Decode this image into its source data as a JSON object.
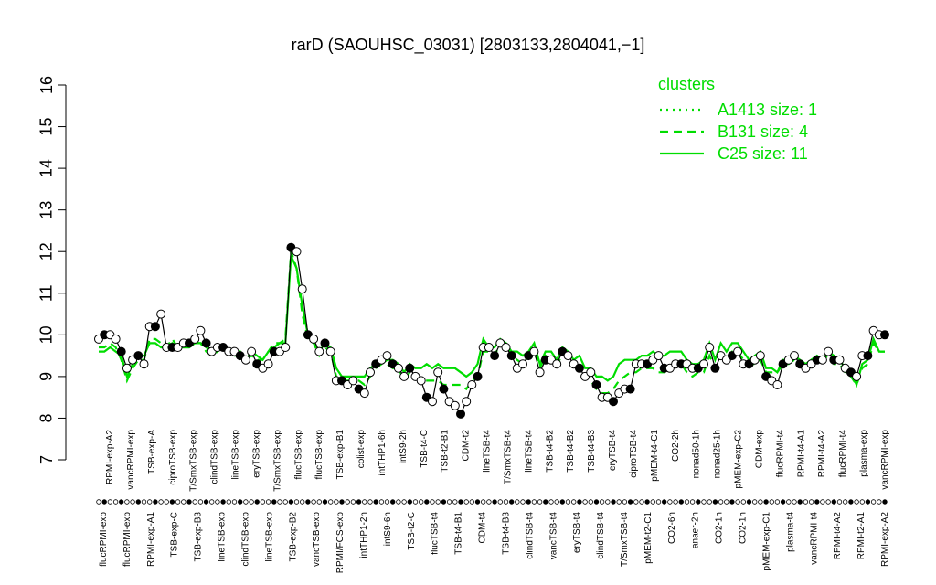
{
  "chart_data": {
    "type": "line",
    "title": "rarD (SAOUHSC_03031) [2803133,2804041,−1]",
    "xlabel": "",
    "ylabel": "",
    "ylim": [
      7,
      16
    ],
    "yticks": [
      7,
      8,
      9,
      10,
      11,
      12,
      13,
      14,
      15,
      16
    ],
    "legend": {
      "title": "clusters",
      "position": "top-right",
      "color": "#00dd00",
      "items": [
        {
          "label": "A1413 size: 1",
          "dash": "dotted"
        },
        {
          "label": "B131 size: 4",
          "dash": "dashed"
        },
        {
          "label": "C25 size: 11",
          "dash": "solid"
        }
      ]
    },
    "top_labels": [
      "RPMI-exp-A2",
      "vancRPMI-exp",
      "TSB-exp-A",
      "ciproTSB-exp",
      "T/SmxTSB-exp",
      "clindTSB-exp",
      "lineTSB-exp",
      "eryTSB-exp",
      "T/SmxTSB-exp",
      "flucTSB-exp",
      "flucTSB-exp",
      "TSB-exp-B1",
      "colist-exp",
      "intTHP1-6h",
      "intS9-2h",
      "TSB-t4-C",
      "TSB-t2-B1",
      "CDM-t2",
      "lineTSB-t4",
      "T/SmxTSB-t4",
      "lineTSB-t4",
      "TSB-t4-B2",
      "TSB-t4-B2",
      "TSB-t4-B3",
      "eryTSB-t4",
      "ciproTSB-t4",
      "pMEM-t4-C1",
      "CO2-2h",
      "nonad50-1h",
      "nonad25-1h",
      "pMEM-exp-C2",
      "CDM-exp",
      "flucRPMI-t4",
      "RPMI-t4-A1",
      "RPMI-t4-A2",
      "flucRPMI-t4",
      "plasma-exp",
      "vancRPMI-exp"
    ],
    "bottom_labels": [
      "flucRPMI-exp",
      "flucRPMI-exp",
      "RPMI-exp-A1",
      "TSB-exp-C",
      "TSB-exp-B3",
      "lineTSB-exp",
      "clindTSB-exp",
      "lineTSB-exp",
      "TSB-exp-B2",
      "vancTSB-exp",
      "RPMI/FCS-exp",
      "intTHP1-2h",
      "intS9-6h",
      "TSB-t2-C",
      "flucTSB-t4",
      "TSB-t4-B1",
      "CDM-t4",
      "TSB-t4-B3",
      "clindTSB-t4",
      "vancTSB-t4",
      "eryTSB-t4",
      "clindTSB-t4",
      "T/SmxTSB-t4",
      "pMEM-t2-C1",
      "CO2-6h",
      "anaer-2h",
      "CO2-1h",
      "CO2-1h",
      "pMEM-exp-C1",
      "plasma-t4",
      "vancRPMI-t4",
      "RPMI-t4-A2",
      "RPMI-t2-A1",
      "RPMI-exp-A2"
    ],
    "series": [
      {
        "name": "C25 size: 11",
        "style": "solid",
        "x": [
          1,
          2,
          3,
          4,
          5,
          6,
          7,
          8,
          9,
          10,
          11,
          12,
          13,
          14,
          15,
          16,
          17,
          18,
          19,
          20,
          21,
          22,
          23,
          24,
          25,
          26,
          27,
          28,
          29,
          30,
          31,
          32,
          33,
          34,
          35,
          36,
          37,
          38,
          39,
          40,
          41,
          42,
          43,
          44,
          45,
          46,
          47,
          48,
          49,
          50,
          51,
          52,
          53,
          54,
          55,
          56,
          57,
          58,
          59,
          60,
          61,
          62,
          63,
          64,
          65,
          66,
          67,
          68,
          69,
          70,
          71,
          72,
          73,
          74,
          75,
          76,
          77,
          78,
          79,
          80,
          81,
          82,
          83,
          84,
          85,
          86,
          87,
          88,
          89,
          90,
          91,
          92,
          93,
          94,
          95,
          96,
          97,
          98,
          99,
          100,
          101,
          102,
          103,
          104,
          105,
          106,
          107,
          108,
          109,
          110,
          111,
          112,
          113,
          114,
          115,
          116,
          117,
          118,
          119,
          120,
          121,
          122,
          123,
          124,
          125,
          126,
          127,
          128,
          129,
          130,
          131,
          132,
          133,
          134,
          135,
          136,
          137,
          138,
          139,
          140
        ],
        "values": [
          9.6,
          9.6,
          9.7,
          9.6,
          9.5,
          9.0,
          9.3,
          9.5,
          9.5,
          9.8,
          9.8,
          9.7,
          9.7,
          9.8,
          9.7,
          9.7,
          9.7,
          9.8,
          9.8,
          9.7,
          9.6,
          9.6,
          9.7,
          9.6,
          9.5,
          9.5,
          9.4,
          9.6,
          9.5,
          9.4,
          9.6,
          9.7,
          9.8,
          9.8,
          11.9,
          11.6,
          10.7,
          10.0,
          9.8,
          9.6,
          9.8,
          9.7,
          9.2,
          9.0,
          9.0,
          9.0,
          9.0,
          9.0,
          9.2,
          9.3,
          9.3,
          9.4,
          9.4,
          9.3,
          9.1,
          9.3,
          9.2,
          9.2,
          9.3,
          9.2,
          9.3,
          9.2,
          9.2,
          9.2,
          9.1,
          9.0,
          9.1,
          9.3,
          9.9,
          9.7,
          9.7,
          9.9,
          9.8,
          9.6,
          9.6,
          9.5,
          9.6,
          9.8,
          9.3,
          9.6,
          9.6,
          9.4,
          9.7,
          9.6,
          9.4,
          9.5,
          9.2,
          9.2,
          9.0,
          9.0,
          8.9,
          9.0,
          9.3,
          9.4,
          9.4,
          9.4,
          9.5,
          9.5,
          9.6,
          9.5,
          9.5,
          9.6,
          9.6,
          9.6,
          9.4,
          9.3,
          9.3,
          9.4,
          9.8,
          9.4,
          9.8,
          9.6,
          9.8,
          9.8,
          9.6,
          9.4,
          9.5,
          9.6,
          9.2,
          9.2,
          9.1,
          9.4,
          9.4,
          9.5,
          9.4,
          9.3,
          9.4,
          9.5,
          9.4,
          9.6,
          9.5,
          9.4,
          9.2,
          9.1,
          8.8,
          9.3,
          9.4,
          9.9,
          9.6,
          9.6
        ]
      },
      {
        "name": "B131 size: 4",
        "style": "dashed",
        "x": [
          1,
          2,
          3,
          4,
          5,
          6,
          7,
          8,
          9,
          10,
          11,
          12,
          13,
          14,
          15,
          16,
          17,
          18,
          19,
          20,
          21,
          22,
          23,
          24,
          25,
          26,
          27,
          28,
          29,
          30,
          31,
          32,
          33,
          34,
          35,
          36,
          37,
          38,
          39,
          40,
          41,
          42,
          43,
          44,
          45,
          46,
          47,
          48,
          49,
          50,
          51,
          52,
          53,
          54,
          55,
          56,
          57,
          58,
          59,
          60,
          61,
          62,
          63,
          64,
          65,
          66,
          67,
          68,
          69,
          70,
          71,
          72,
          73,
          74,
          75,
          76,
          77,
          78,
          79,
          80,
          81,
          82,
          83,
          84,
          85,
          86,
          87,
          88,
          89,
          90,
          91,
          92,
          93,
          94,
          95,
          96,
          97,
          98,
          99,
          100,
          101,
          102,
          103,
          104,
          105,
          106,
          107,
          108,
          109,
          110,
          111,
          112,
          113,
          114,
          115,
          116,
          117,
          118,
          119,
          120,
          121,
          122,
          123,
          124,
          125,
          126,
          127,
          128,
          129,
          130,
          131,
          132,
          133,
          134,
          135,
          136,
          137,
          138,
          139,
          140
        ],
        "values": [
          9.7,
          9.7,
          9.8,
          9.7,
          9.4,
          8.9,
          9.2,
          9.4,
          9.4,
          9.9,
          9.9,
          9.8,
          9.7,
          9.9,
          9.7,
          9.7,
          9.7,
          9.8,
          9.8,
          9.6,
          9.5,
          9.6,
          9.7,
          9.6,
          9.5,
          9.6,
          9.4,
          9.5,
          9.4,
          9.4,
          9.6,
          9.8,
          9.8,
          9.9,
          12.0,
          11.6,
          10.5,
          9.9,
          9.8,
          9.5,
          9.7,
          9.6,
          9.0,
          8.9,
          8.9,
          8.9,
          8.9,
          8.8,
          9.0,
          9.2,
          9.3,
          9.3,
          9.2,
          9.2,
          8.9,
          9.1,
          9.0,
          8.9,
          8.9,
          8.9,
          8.9,
          8.8,
          8.8,
          8.8,
          8.8,
          8.7,
          8.9,
          9.0,
          9.6,
          9.6,
          9.5,
          9.8,
          9.8,
          9.5,
          9.4,
          9.3,
          9.5,
          9.6,
          9.2,
          9.5,
          9.4,
          9.3,
          9.5,
          9.5,
          9.3,
          9.2,
          9.0,
          8.9,
          8.7,
          8.6,
          8.6,
          8.7,
          8.9,
          9.0,
          9.1,
          9.1,
          9.2,
          9.2,
          9.2,
          9.1,
          9.1,
          9.2,
          9.3,
          9.3,
          9.1,
          9.0,
          9.1,
          9.1,
          9.5,
          9.2,
          9.5,
          9.4,
          9.6,
          9.6,
          9.4,
          9.3,
          9.3,
          9.4,
          9.1,
          9.1,
          9.1,
          9.3,
          9.3,
          9.4,
          9.3,
          9.2,
          9.4,
          9.4,
          9.4,
          9.5,
          9.3,
          9.3,
          9.1,
          9.0,
          8.8,
          9.2,
          9.3,
          9.8,
          9.6,
          9.6
        ]
      },
      {
        "name": "A1413 size: 1",
        "style": "dotted",
        "x": [
          1,
          2,
          3,
          4,
          5,
          6,
          7,
          8,
          9,
          10,
          11,
          12,
          13,
          14,
          15,
          16,
          17,
          18,
          19,
          20,
          21,
          22,
          23,
          24,
          25,
          26,
          27,
          28,
          29,
          30,
          31,
          32,
          33,
          34,
          35,
          36,
          37,
          38,
          39,
          40,
          41,
          42,
          43,
          44,
          45,
          46,
          47,
          48,
          49,
          50,
          51,
          52,
          53,
          54,
          55,
          56,
          57,
          58,
          59,
          60,
          61,
          62,
          63,
          64,
          65,
          66,
          67,
          68,
          69,
          70,
          71,
          72,
          73,
          74,
          75,
          76,
          77,
          78,
          79,
          80,
          81,
          82,
          83,
          84,
          85,
          86,
          87,
          88,
          89,
          90,
          91,
          92,
          93,
          94,
          95,
          96,
          97,
          98,
          99,
          100,
          101,
          102,
          103,
          104,
          105,
          106,
          107,
          108,
          109,
          110,
          111,
          112,
          113,
          114,
          115,
          116,
          117,
          118,
          119,
          120,
          121,
          122,
          123,
          124,
          125,
          126,
          127,
          128,
          129,
          130,
          131,
          132,
          133,
          134,
          135,
          136,
          137,
          138,
          139,
          140
        ],
        "values": [
          9.9,
          10.0,
          10.0,
          9.9,
          9.6,
          9.2,
          9.4,
          9.5,
          9.3,
          10.2,
          10.2,
          10.5,
          9.7,
          9.7,
          9.7,
          9.8,
          9.8,
          9.9,
          10.1,
          9.8,
          9.6,
          9.7,
          9.7,
          9.6,
          9.6,
          9.5,
          9.4,
          9.6,
          9.3,
          9.2,
          9.3,
          9.6,
          9.6,
          9.7,
          12.1,
          12.0,
          11.1,
          10.0,
          9.9,
          9.6,
          9.8,
          9.6,
          8.9,
          8.9,
          8.8,
          8.9,
          8.7,
          8.6,
          9.1,
          9.3,
          9.4,
          9.5,
          9.3,
          9.2,
          9.0,
          9.2,
          9.0,
          8.9,
          8.5,
          8.4,
          9.1,
          8.7,
          8.4,
          8.3,
          8.1,
          8.4,
          8.8,
          9.0,
          9.7,
          9.7,
          9.5,
          9.8,
          9.7,
          9.5,
          9.2,
          9.3,
          9.5,
          9.6,
          9.1,
          9.4,
          9.4,
          9.3,
          9.6,
          9.5,
          9.3,
          9.2,
          9.0,
          9.1,
          8.8,
          8.5,
          8.5,
          8.4,
          8.6,
          8.7,
          8.7,
          9.3,
          9.3,
          9.3,
          9.4,
          9.5,
          9.2,
          9.2,
          9.3,
          9.3,
          9.3,
          9.2,
          9.2,
          9.3,
          9.7,
          9.2,
          9.5,
          9.4,
          9.5,
          9.6,
          9.3,
          9.3,
          9.4,
          9.5,
          9.0,
          8.9,
          8.8,
          9.3,
          9.4,
          9.5,
          9.3,
          9.2,
          9.3,
          9.4,
          9.4,
          9.6,
          9.4,
          9.4,
          9.2,
          9.1,
          9.0,
          9.5,
          9.5,
          10.1,
          10.0,
          10.0
        ]
      }
    ]
  }
}
